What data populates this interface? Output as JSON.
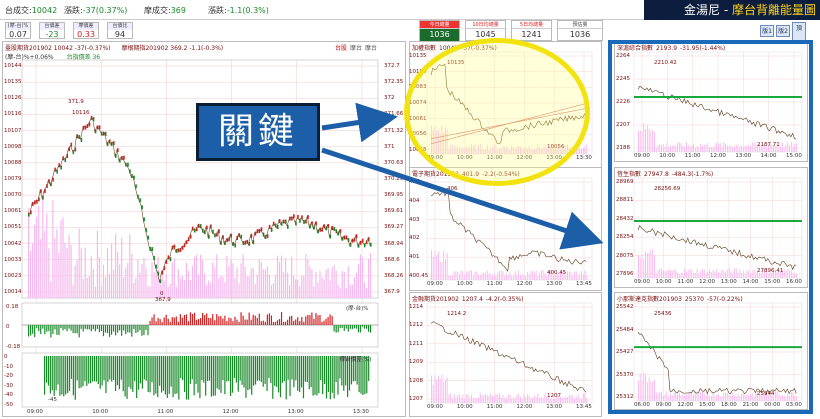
{
  "ticker": {
    "taiex_label": "台成交:",
    "taiex_value": "10042",
    "chg_label": "漲跌:",
    "chg_value": "-37(0.37%)",
    "tx_label": "摩成交:",
    "tx_value": "369",
    "txchg_label": "漲跌:",
    "txchg_value": "-1.1(0.3%)"
  },
  "brand": {
    "name": "金湯尼 - ",
    "title": "摩台背離能量圖"
  },
  "summary": [
    {
      "label": "(摩-台)%",
      "value": "0.07"
    },
    {
      "label": "台價差",
      "value": "-23"
    },
    {
      "label": "摩價差",
      "value": "0.33"
    },
    {
      "label": "台價比",
      "value": "94"
    }
  ],
  "volumes": [
    {
      "label": "今日總量",
      "value": "1036",
      "active": true
    },
    {
      "label": "10日均總量",
      "value": "1045",
      "active": false
    },
    {
      "label": "5日均總量",
      "value": "1241",
      "active": false
    },
    {
      "label": "預估量",
      "value": "1036",
      "active": false
    }
  ],
  "page_buttons": [
    "版1",
    "版2",
    "頂"
  ],
  "main_chart": {
    "header": {
      "taiex": "臺股期貨201902 10042 -37(-0.37%)",
      "msci": "摩根期指201902 369.2 -1.1(-0.3%)"
    },
    "sub_header": {
      "diff": "(摩-台)%+0.06%",
      "basis": "台指價差 36"
    },
    "legend": [
      "台股",
      "摩台",
      "摩台"
    ],
    "left_ticks": [
      "10144",
      "10135",
      "10126",
      "10116",
      "10107",
      "10098",
      "10088",
      "10079",
      "10070",
      "10061",
      "10051",
      "10042",
      "10033",
      "10023",
      "10014"
    ],
    "right_ticks": [
      "372.7",
      "372.35",
      "372",
      "371.66",
      "371.32",
      "371",
      "370.63",
      "370.29",
      "369.95",
      "369.61",
      "369.27",
      "368.94",
      "368.6",
      "368.26",
      "367.9"
    ],
    "high_label": "371.9",
    "high_label2": "10116",
    "low_label": "367.9",
    "low_label2": "0",
    "x_ticks": [
      "09:00",
      "10:00",
      "11:00",
      "12:00",
      "13:00",
      "13:30"
    ],
    "osc1": {
      "label": "(摩-台)%",
      "ticks": [
        "0.18",
        "0",
        "-0.18"
      ]
    },
    "osc2": {
      "label": "摩台價差(%)",
      "ticks": [
        "0",
        "-10",
        "-20",
        "-30",
        "-40",
        "-50"
      ],
      "min_label": "-45"
    }
  },
  "mini_charts": [
    {
      "title": "加權指數",
      "value": "10042",
      "chg": "-37(-0.37%)",
      "hi_label": "10135",
      "lo_label": "10056",
      "ticks": [
        "10135",
        "10109",
        "10083",
        "10074",
        "10061",
        "10056",
        "10048"
      ],
      "x_ticks": [
        "09:00",
        "10:00",
        "11:00",
        "12:00",
        "13:00",
        "13:30"
      ]
    },
    {
      "title": "電子期貨201902",
      "value": "401.9",
      "chg": "-2.2(-0.54%)",
      "hi_label": "406",
      "lo_label": "400.45",
      "ticks": [
        "406",
        "404",
        "403",
        "402",
        "401",
        "400.45"
      ],
      "x_ticks": [
        "09:00",
        "10:00",
        "11:00",
        "12:00",
        "13:00",
        "13:45"
      ]
    },
    {
      "title": "金融期貨201902",
      "value": "1207.4",
      "chg": "-4.2(-0.35%)",
      "hi_label": "1214.2",
      "lo_label": "1207",
      "ticks": [
        "1214",
        "1212",
        "1211",
        "1209",
        "1208",
        "1207"
      ],
      "x_ticks": [
        "09:00",
        "10:00",
        "11:00",
        "12:00",
        "13:00",
        "13:45"
      ]
    },
    {
      "title": "深滬綜合指數",
      "value": "2193.9",
      "chg": "-31.95(-1.44%)",
      "hi_label": "2210.42",
      "lo_label": "2187.71",
      "ticks": [
        "2264",
        "2245",
        "2226",
        "2207",
        "2188"
      ],
      "x_ticks": [
        "09:00",
        "10:00",
        "11:00",
        "12:00",
        "13:00",
        "14:00",
        "15:00"
      ]
    },
    {
      "title": "恆生指數",
      "value": "27947.8",
      "chg": "-484.3(-1.7%)",
      "hi_label": "28256.69",
      "lo_label": "27896.41",
      "ticks": [
        "28969",
        "28811",
        "28432",
        "28254",
        "28075",
        "27896"
      ],
      "x_ticks": [
        "09:00",
        "10:00",
        "11:00",
        "12:00",
        "13:00",
        "14:00",
        "15:00",
        "16:00"
      ]
    },
    {
      "title": "小那斯達克指數201903",
      "value": "25370",
      "chg": "-57(-0.22%)",
      "hi_label": "25436",
      "lo_label": "25344",
      "ticks": [
        "25542",
        "25484",
        "25427",
        "25370",
        "25312"
      ],
      "x_ticks": [
        "06:00",
        "09:00",
        "12:00",
        "15:00",
        "18:00",
        "21:00",
        "00:00",
        "03:00"
      ]
    }
  ],
  "callout": "關鍵",
  "colors": {
    "up": "#d42020",
    "down": "#1a8a2a",
    "highlight": "#f2e310",
    "box": "#1b6ab9",
    "vol": "#f6b8ee"
  }
}
